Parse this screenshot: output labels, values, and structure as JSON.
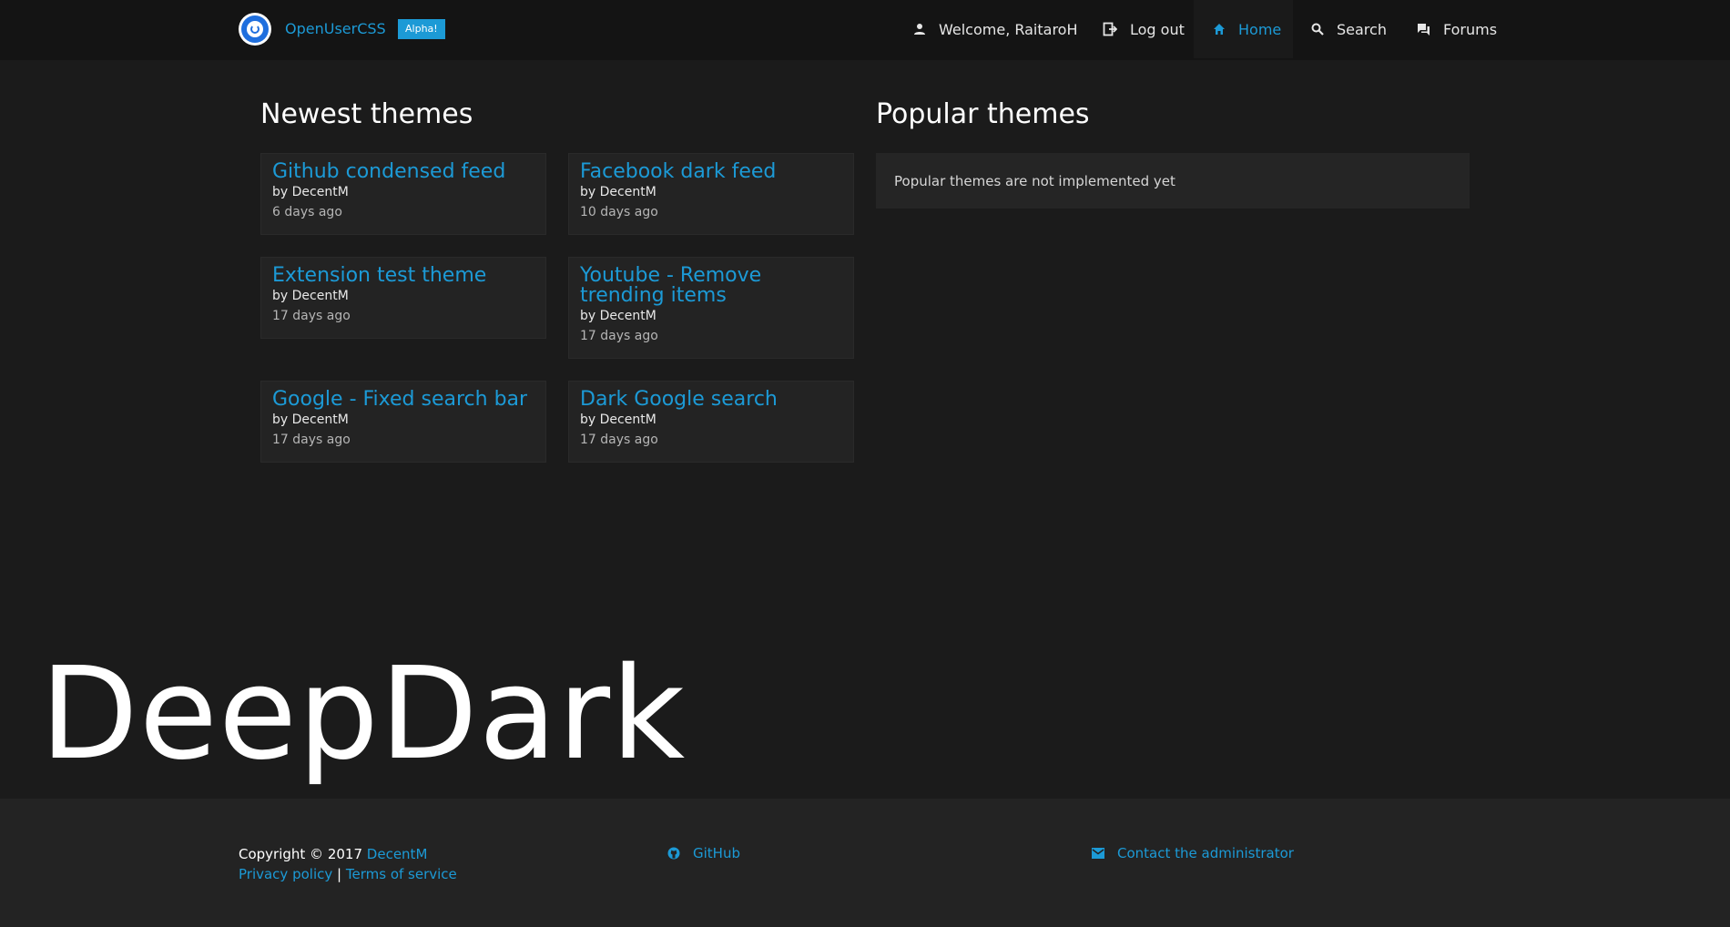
{
  "header": {
    "brand": "OpenUserCSS",
    "badge": "Alpha!",
    "nav": {
      "welcome": "Welcome, RaitaroH",
      "logout": "Log out",
      "home": "Home",
      "search": "Search",
      "forums": "Forums"
    }
  },
  "newest": {
    "title": "Newest themes",
    "themes": [
      {
        "name": "Github condensed feed",
        "author": "by DecentM",
        "date": "6 days ago"
      },
      {
        "name": "Facebook dark feed",
        "author": "by DecentM",
        "date": "10 days ago"
      },
      {
        "name": "Extension test theme",
        "author": "by DecentM",
        "date": "17 days ago"
      },
      {
        "name": "Youtube - Remove trending items",
        "author": "by DecentM",
        "date": "17 days ago"
      },
      {
        "name": "Google - Fixed search bar",
        "author": "by DecentM",
        "date": "17 days ago"
      },
      {
        "name": "Dark Google search",
        "author": "by DecentM",
        "date": "17 days ago"
      }
    ]
  },
  "popular": {
    "title": "Popular themes",
    "message": "Popular themes are not implemented yet"
  },
  "watermark": "DeepDark",
  "footer": {
    "copyright": "Copyright © 2017",
    "author_link": "DecentM",
    "privacy": "Privacy policy",
    "separator": "|",
    "terms": "Terms of service",
    "github": "GitHub",
    "contact": "Contact the administrator"
  },
  "colors": {
    "accent": "#1c9ad6",
    "background": "#1b1b1b",
    "header": "#141414",
    "card": "#232323",
    "footer": "#232323"
  },
  "icons": {
    "logo": "openusercss-logo-icon",
    "user": "person-icon",
    "logout": "logout-icon",
    "home": "home-icon",
    "search": "search-icon",
    "forums": "forum-icon",
    "github": "github-icon",
    "mail": "mail-icon"
  }
}
